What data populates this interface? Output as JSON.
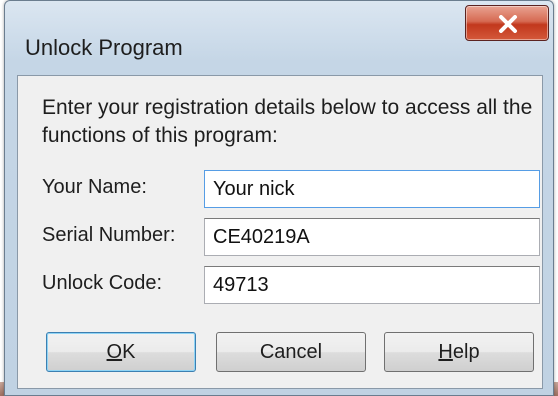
{
  "window": {
    "title": "Unlock Program",
    "close_glyph": "X"
  },
  "instructions": "Enter your registration details below to access all the functions of this program:",
  "fields": [
    {
      "label": "Your Name:",
      "value": "Your nick"
    },
    {
      "label": "Serial Number:",
      "value": "CE40219A"
    },
    {
      "label": "Unlock Code:",
      "value": "49713"
    }
  ],
  "buttons": {
    "ok": {
      "mnemonic": "O",
      "rest": "K"
    },
    "cancel": {
      "label": "Cancel"
    },
    "help": {
      "mnemonic": "H",
      "rest": "elp"
    }
  },
  "colors": {
    "frame": "#c0d2e3",
    "close_button": "#c2381d",
    "focus_border": "#569de5"
  }
}
